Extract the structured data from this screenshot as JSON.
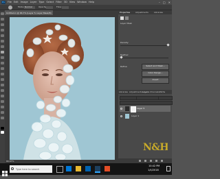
{
  "menubar": {
    "logo": "Ps",
    "items": [
      "File",
      "Edit",
      "Image",
      "Layer",
      "Type",
      "Select",
      "Filter",
      "3D",
      "View",
      "Window",
      "Help"
    ],
    "window_controls": [
      "–",
      "□",
      "✕"
    ]
  },
  "options_bar": {
    "mode_label": "Mode:",
    "mode_value": "Normal",
    "opacity_label": "Opacity:",
    "flow_label": "Flow:"
  },
  "document": {
    "tab_title": "Untitled-1 @ 66.7% (Layer 5, Layer Mask/8)",
    "status_text": "66.67%"
  },
  "panels": {
    "top_tabs": [
      "Properties",
      "Adjustments",
      "Libraries"
    ],
    "active_top_tab": "Properties",
    "properties": {
      "section_title": "Layer Mask",
      "density_label": "Density:",
      "feather_label": "Feather:",
      "refine_label": "Refine:",
      "select_and_mask": "Select and Mask...",
      "color_range": "Color Range...",
      "invert": "Invert"
    },
    "bottom_tabs": [
      "Libraries",
      "Adjustments",
      "Layers",
      "Channels",
      "Paths"
    ],
    "active_bottom_tab": "Layers",
    "layers": [
      {
        "name": "Layer 5"
      },
      {
        "name": "Layer 1"
      }
    ],
    "colors": {
      "panel_bg": "#494949",
      "selected_row": "#676767"
    }
  },
  "watermark": "NAH",
  "taskbar": {
    "search_placeholder": "Type here to search",
    "time": "10:42 PM",
    "date": "1/4/2018"
  },
  "colors": {
    "canvas_bg": "#9fc6d3",
    "watermark": "#c6a92a"
  }
}
